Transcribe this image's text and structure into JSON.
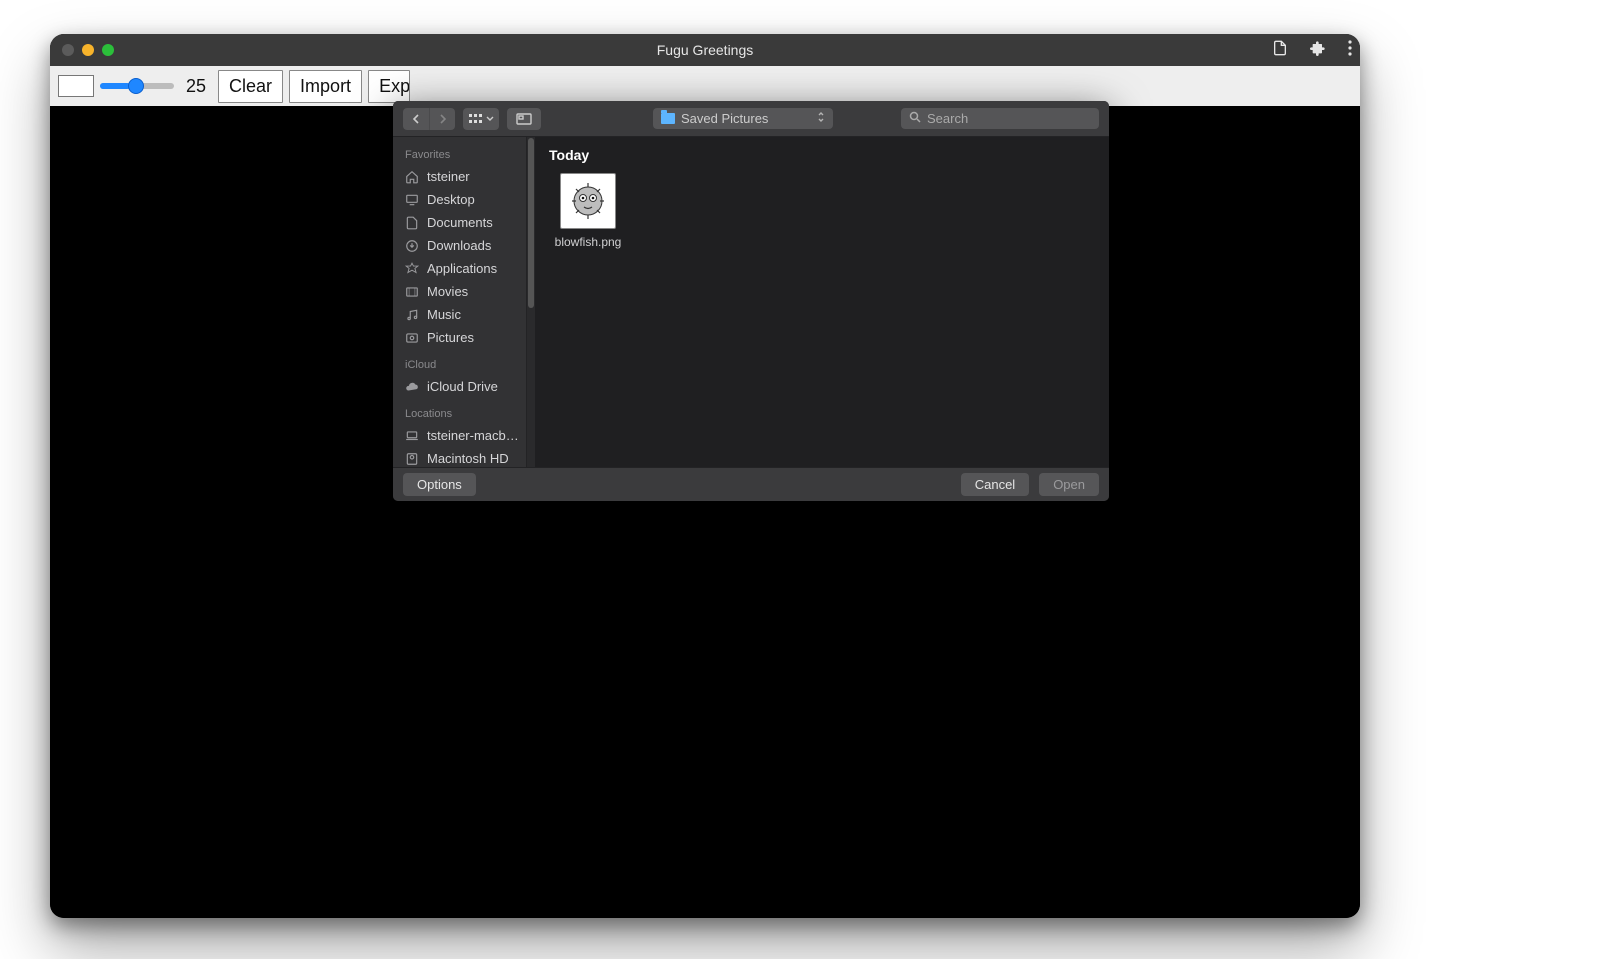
{
  "app": {
    "title": "Fugu Greetings"
  },
  "traffic": {
    "close": "#5b5b5b",
    "min": "#f7b32b",
    "max": "#2bbf3a"
  },
  "toolbar": {
    "slider_value": "25",
    "buttons": {
      "clear": "Clear",
      "import": "Import",
      "export": "Export"
    }
  },
  "picker": {
    "location": "Saved Pictures",
    "search_placeholder": "Search",
    "sidebar": {
      "sections": [
        {
          "header": "Favorites",
          "items": [
            {
              "icon": "home",
              "label": "tsteiner"
            },
            {
              "icon": "desktop",
              "label": "Desktop"
            },
            {
              "icon": "doc",
              "label": "Documents"
            },
            {
              "icon": "download",
              "label": "Downloads"
            },
            {
              "icon": "apps",
              "label": "Applications"
            },
            {
              "icon": "movie",
              "label": "Movies"
            },
            {
              "icon": "music",
              "label": "Music"
            },
            {
              "icon": "pictures",
              "label": "Pictures"
            }
          ]
        },
        {
          "header": "iCloud",
          "items": [
            {
              "icon": "cloud",
              "label": "iCloud Drive"
            }
          ]
        },
        {
          "header": "Locations",
          "items": [
            {
              "icon": "laptop",
              "label": "tsteiner-macb…"
            },
            {
              "icon": "disk",
              "label": "Macintosh HD"
            }
          ]
        }
      ]
    },
    "content": {
      "section": "Today",
      "files": [
        {
          "name": "blowfish.png"
        }
      ]
    },
    "footer": {
      "options": "Options",
      "cancel": "Cancel",
      "open": "Open"
    }
  }
}
